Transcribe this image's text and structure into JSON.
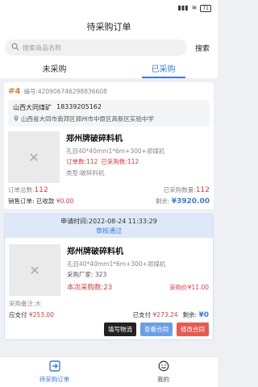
{
  "status_bar": {
    "signal": "▮▮▮",
    "wifi": "≋",
    "battery": "71"
  },
  "header": {
    "title": "待采购订单"
  },
  "search": {
    "placeholder": "搜索商品名称",
    "button_label": "搜索"
  },
  "tabs": [
    {
      "label": "未采购",
      "active": false
    },
    {
      "label": "已采购",
      "active": true
    }
  ],
  "order1": {
    "index": "#4",
    "order_no": "编号:420906746298836608",
    "addr_name": "山西大同煤矿",
    "addr_phone": "18339205162",
    "addr_line": "山西省大同市南郊区郑州市中原区高新区实验中学",
    "product_title": "郑州牌破碎料机",
    "spec": "孔目40*40mm1*6m+300+郑煤机",
    "ordered_qty_label": "订单数:112",
    "purchased_qty_label": "已采购数:112",
    "category": "类型:破碎料机",
    "total_label": "订单总数:",
    "total_value": "112",
    "purchased_label": "已采购数量:",
    "purchased_value": "112",
    "sales_order_label": "销售订单:",
    "sales_order_value": "已收款",
    "sales_order_symbol": "¥0.00",
    "remain_label": "剩余:",
    "remain_value": "¥3920.00"
  },
  "order2": {
    "apply_time": "申请时间:2022-08-24 11:33:29",
    "status": "审核通过",
    "product_title": "郑州牌破碎料机",
    "spec": "孔目40*40mm1*6m+300+郑煤机",
    "vendor": "采购厂家: 323",
    "this_qty": "本次采购数:23",
    "this_price": "采购价¥11.00",
    "note": "采购备注:大",
    "payable_label": "应支付",
    "payable_value": "¥253.00",
    "paid_label": "已支付",
    "paid_value": "¥273.24",
    "remain_label": "剩余:",
    "remain_value": "¥0",
    "buttons": {
      "fill_logistics": "填写物流",
      "view_contract": "查看合同",
      "edit_contract": "修改合同"
    }
  },
  "bottom_nav": [
    {
      "label": "待采购订单",
      "active": true
    },
    {
      "label": "我的",
      "active": false
    }
  ],
  "colors": {
    "accent": "#3a7be8",
    "red": "#e0393e",
    "orange": "#e67e22"
  }
}
